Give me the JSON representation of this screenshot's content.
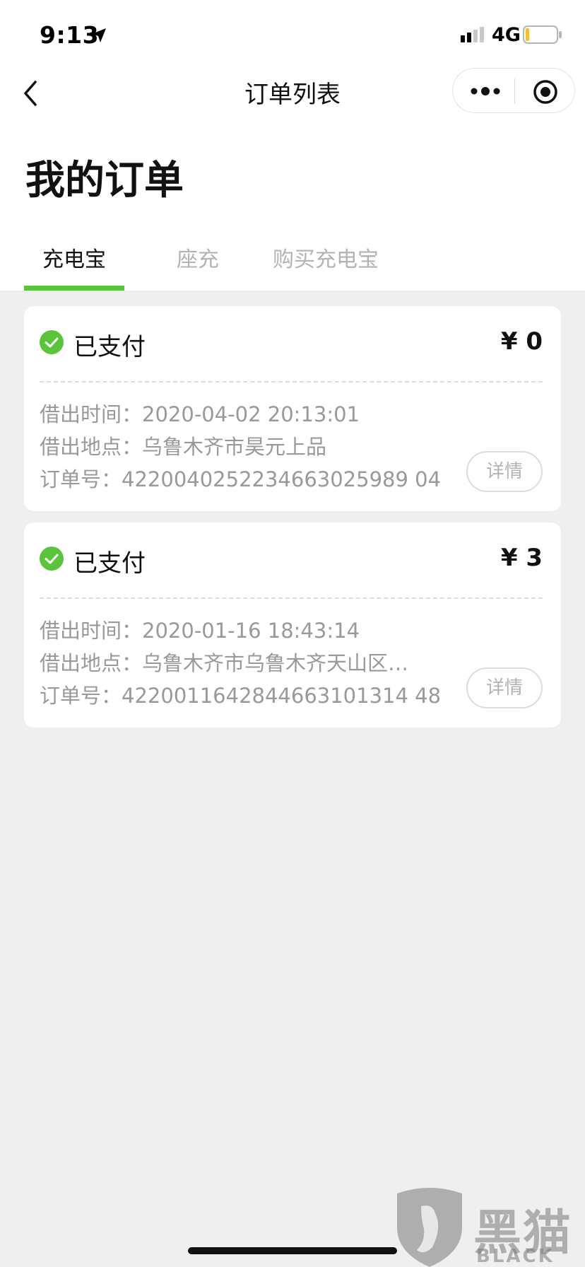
{
  "status_bar": {
    "time": "9:13",
    "network": "4G"
  },
  "nav": {
    "title": "订单列表"
  },
  "page_title": "我的订单",
  "tabs": [
    {
      "label": "充电宝",
      "active": true
    },
    {
      "label": "座充",
      "active": false
    },
    {
      "label": "购买充电宝",
      "active": false
    }
  ],
  "orders": [
    {
      "status": "已支付",
      "price": "¥ 0",
      "rows": [
        {
          "label": "借出时间：",
          "value": "2020-04-02 20:13:01"
        },
        {
          "label": "借出地点：",
          "value": "乌鲁木齐市昊元上品"
        },
        {
          "label": "订单号：",
          "value": "4220040252234663025989 04"
        }
      ],
      "detail_label": "详情"
    },
    {
      "status": "已支付",
      "price": "¥ 3",
      "rows": [
        {
          "label": "借出时间：",
          "value": "2020-01-16 18:43:14"
        },
        {
          "label": "借出地点：",
          "value": "乌鲁木齐市乌鲁木齐天山区…"
        },
        {
          "label": "订单号：",
          "value": "4220011642844663101314 48"
        }
      ],
      "detail_label": "详情"
    }
  ],
  "watermark": {
    "brand_cn": "黑猫",
    "brand_en": "BLACK CAT"
  },
  "colors": {
    "accent": "#5ac43a",
    "background": "#efefef",
    "muted_text": "#999999"
  }
}
